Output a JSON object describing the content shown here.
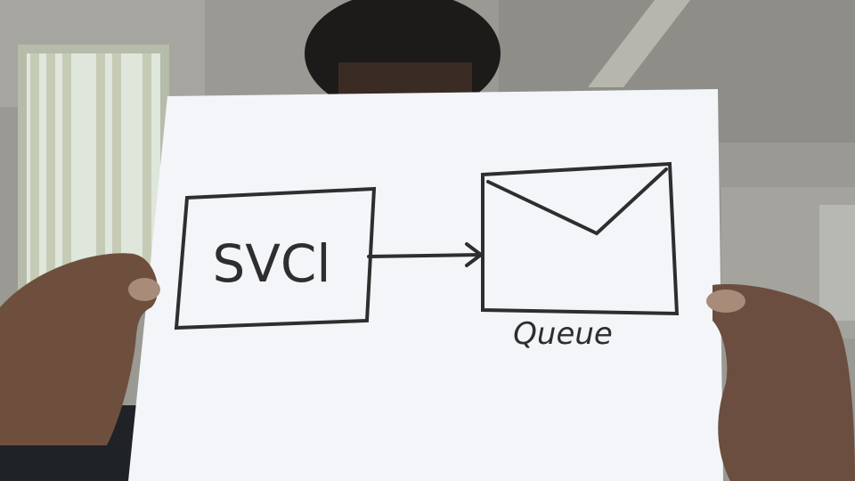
{
  "photo": {
    "subject": "person-holding-paper-sketch",
    "colors": {
      "wall": "#9b9a93",
      "ceiling": "#8d8c86",
      "paper": "#f4f5f8",
      "ink": "#2e2e2e",
      "skin": "#7a5a45",
      "hair": "#1d1b1a",
      "window": "#dfe7dc"
    }
  },
  "sketch": {
    "service_box_text": "SVCl",
    "queue_caption": "Queue",
    "arrow": "service-to-queue",
    "queue_icon": "envelope-icon"
  }
}
